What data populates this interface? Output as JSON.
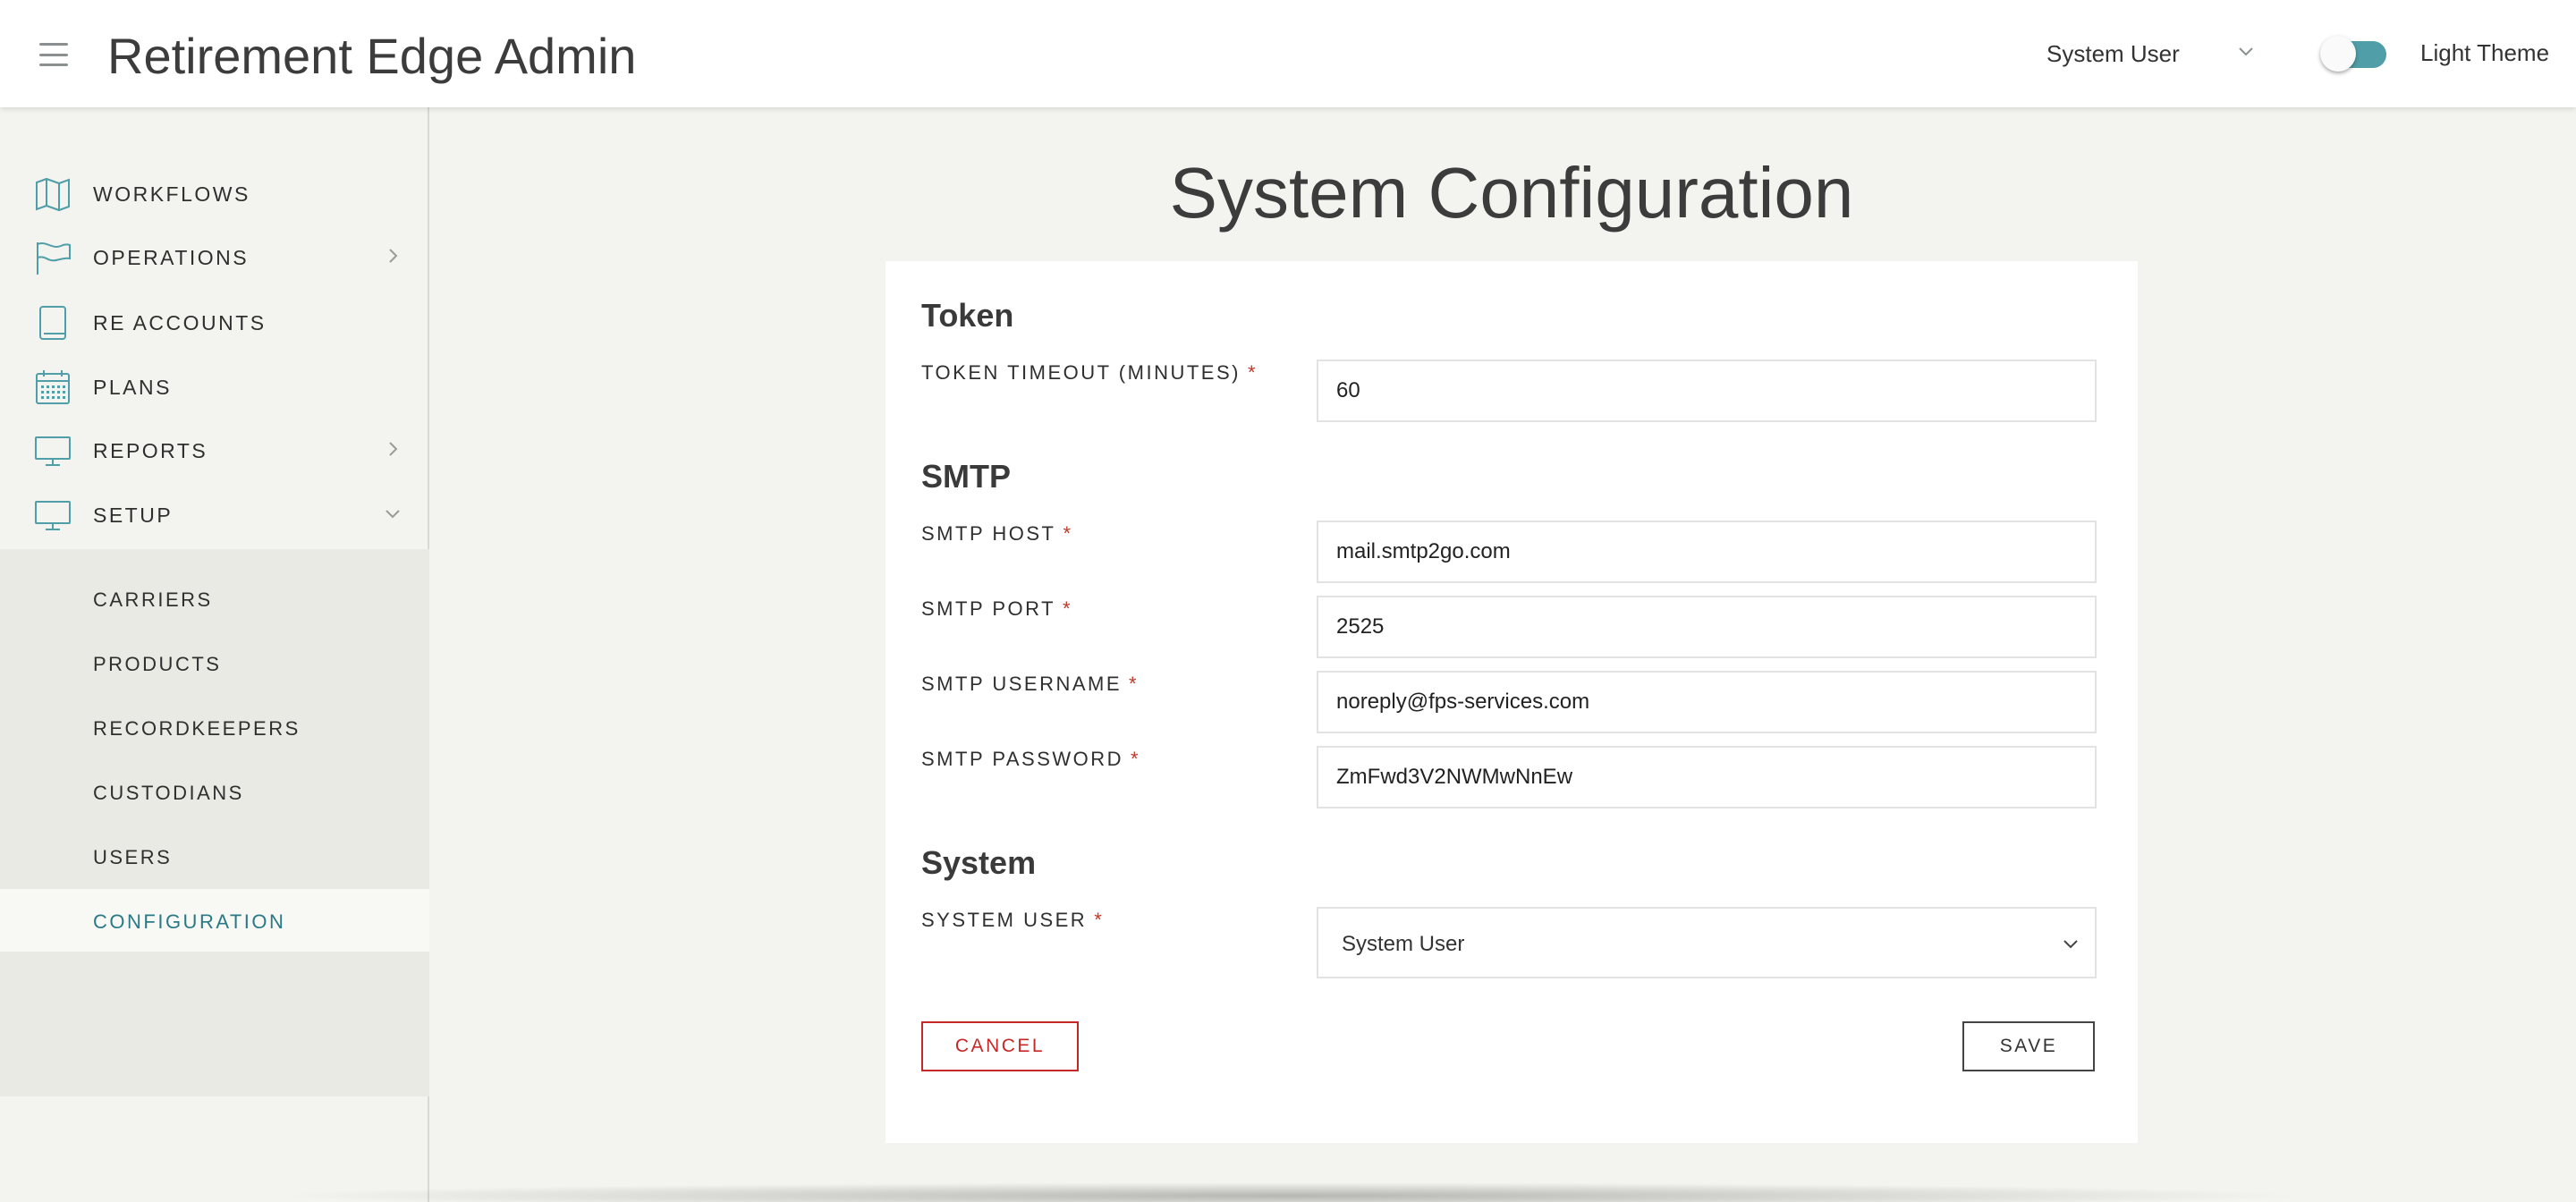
{
  "header": {
    "app_title": "Retirement Edge Admin",
    "user_select_value": "System User",
    "theme_toggle_on": true,
    "theme_label": "Light Theme"
  },
  "sidebar": {
    "items": [
      {
        "label": "WORKFLOWS",
        "icon": "map-icon",
        "has_arrow": false
      },
      {
        "label": "OPERATIONS",
        "icon": "flag-icon",
        "has_arrow": true
      },
      {
        "label": "RE ACCOUNTS",
        "icon": "book-icon",
        "has_arrow": false
      },
      {
        "label": "PLANS",
        "icon": "calendar-icon",
        "has_arrow": false
      },
      {
        "label": "REPORTS",
        "icon": "monitor-icon",
        "has_arrow": true
      },
      {
        "label": "SETUP",
        "icon": "monitor-icon",
        "has_arrow": true,
        "expanded": true
      }
    ],
    "setup_submenu": [
      {
        "label": "CARRIERS"
      },
      {
        "label": "PRODUCTS"
      },
      {
        "label": "RECORDKEEPERS"
      },
      {
        "label": "CUSTODIANS"
      },
      {
        "label": "USERS"
      },
      {
        "label": "CONFIGURATION",
        "active": true
      }
    ]
  },
  "main": {
    "page_title": "System Configuration",
    "sections": {
      "token": {
        "title": "Token",
        "timeout_label": "TOKEN TIMEOUT (MINUTES)",
        "timeout_value": "60"
      },
      "smtp": {
        "title": "SMTP",
        "host_label": "SMTP HOST",
        "host_value": "mail.smtp2go.com",
        "port_label": "SMTP PORT",
        "port_value": "2525",
        "username_label": "SMTP USERNAME",
        "username_value": "noreply@fps-services.com",
        "password_label": "SMTP PASSWORD",
        "password_value": "ZmFwd3V2NWMwNnEw"
      },
      "system": {
        "title": "System",
        "user_label": "SYSTEM USER",
        "user_value": "System User"
      }
    },
    "required_marker": "*",
    "cancel_label": "CANCEL",
    "save_label": "SAVE"
  },
  "colors": {
    "accent": "#4f9ea8",
    "active_nav": "#2a7a86",
    "danger": "#c62828",
    "background": "#f3f3ef"
  }
}
